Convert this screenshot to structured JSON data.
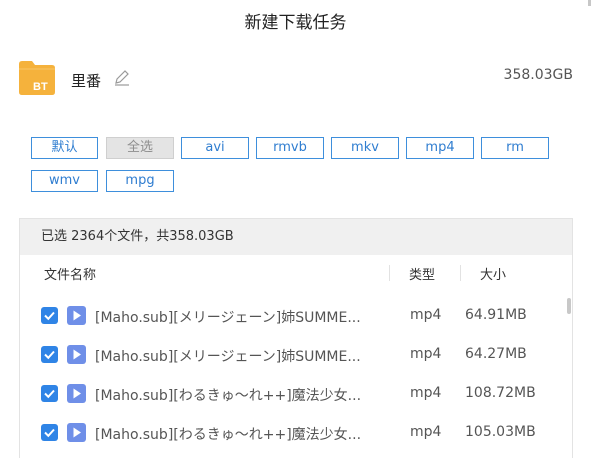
{
  "dialog": {
    "title": "新建下载任务"
  },
  "file": {
    "icon": "bt-folder-icon",
    "icon_label": "BT",
    "name": "里番",
    "total_size": "358.03GB"
  },
  "filters": [
    {
      "label": "默认",
      "selected": false
    },
    {
      "label": "全选",
      "selected": true
    },
    {
      "label": "avi",
      "selected": false
    },
    {
      "label": "rmvb",
      "selected": false
    },
    {
      "label": "mkv",
      "selected": false
    },
    {
      "label": "mp4",
      "selected": false
    },
    {
      "label": "rm",
      "selected": false
    },
    {
      "label": "wmv",
      "selected": false
    },
    {
      "label": "mpg",
      "selected": false
    }
  ],
  "summary": "已选 2364个文件，共358.03GB",
  "columns": {
    "name": "文件名称",
    "type": "类型",
    "size": "大小"
  },
  "rows": [
    {
      "name": "[Maho.sub][メリージェーン]姉SUMME...",
      "type": "mp4",
      "size": "64.91MB",
      "checked": true
    },
    {
      "name": "[Maho.sub][メリージェーン]姉SUMME...",
      "type": "mp4",
      "size": "64.27MB",
      "checked": true
    },
    {
      "name": "[Maho.sub][わるきゅ～れ++]魔法少女...",
      "type": "mp4",
      "size": "108.72MB",
      "checked": true
    },
    {
      "name": "[Maho.sub][わるきゅ～れ++]魔法少女...",
      "type": "mp4",
      "size": "105.03MB",
      "checked": true
    }
  ],
  "colors": {
    "accent": "#2f84e6",
    "button_border": "#3e8fdc",
    "folder": "#f5b23c"
  }
}
